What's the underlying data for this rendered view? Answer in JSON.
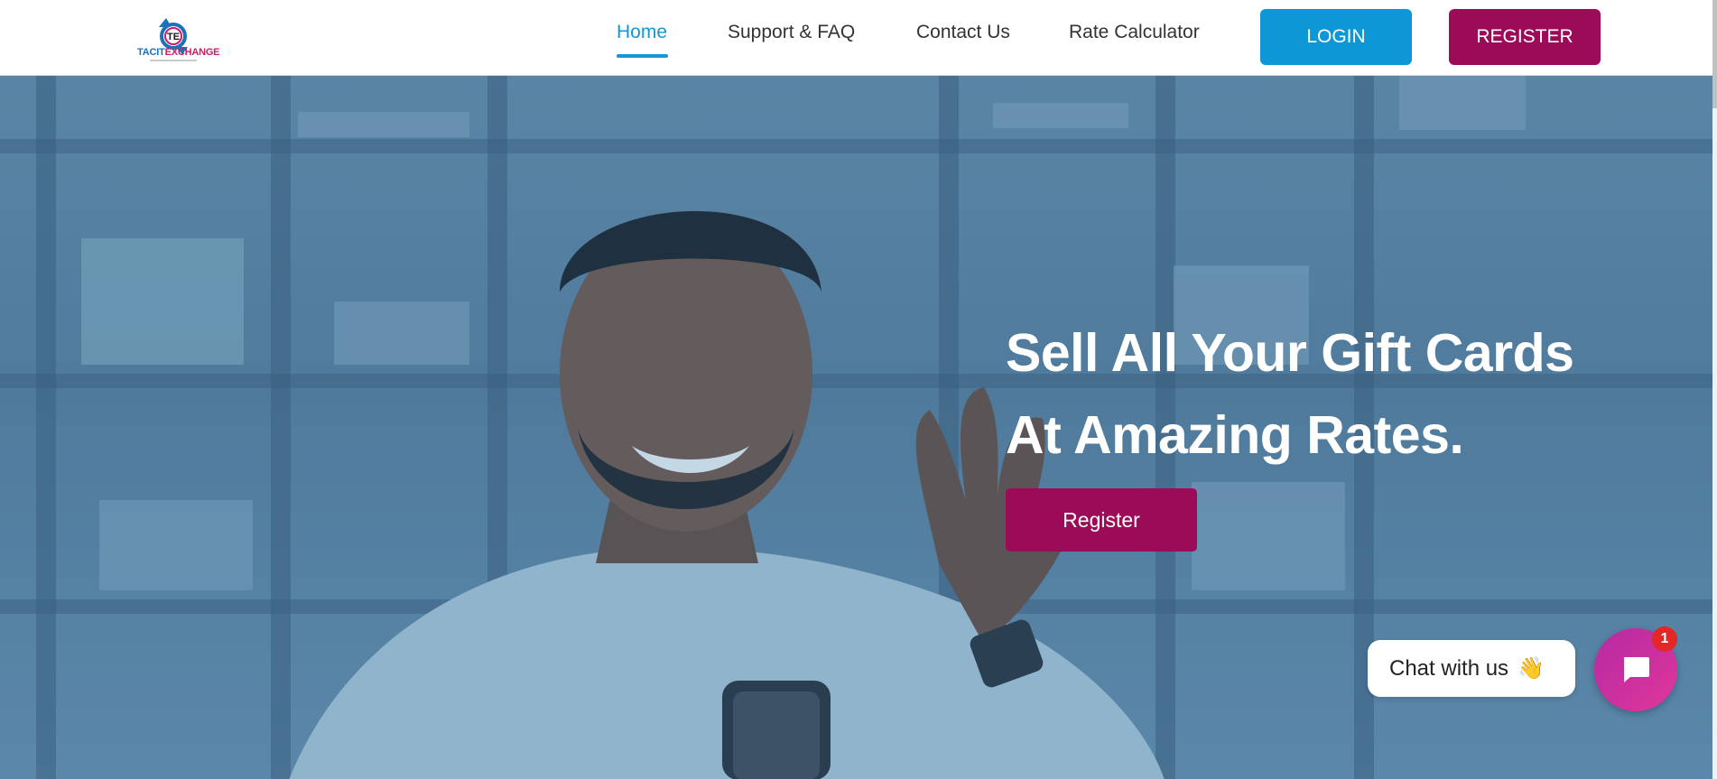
{
  "brand": {
    "logo_initials": "TE",
    "name_part1": "TACIT",
    "name_part2": "EXCHANGE"
  },
  "nav": {
    "items": [
      {
        "label": "Home",
        "active": true
      },
      {
        "label": "Support & FAQ",
        "active": false
      },
      {
        "label": "Contact Us",
        "active": false
      },
      {
        "label": "Rate Calculator",
        "active": false
      }
    ],
    "login_label": "LOGIN",
    "register_label": "REGISTER"
  },
  "hero": {
    "headline_line1": "Sell All Your Gift Cards",
    "headline_line2": "At Amazing Rates.",
    "cta_label": "Register"
  },
  "chat": {
    "pill_text": "Chat with us",
    "wave_emoji": "👋",
    "badge_count": "1",
    "icon": "chat-bubble-icon"
  },
  "colors": {
    "primary_blue": "#0e97d6",
    "brand_magenta": "#9b0b57",
    "chat_gradient_start": "#b52aa3",
    "chat_gradient_end": "#e0369a",
    "badge_red": "#e32626"
  }
}
